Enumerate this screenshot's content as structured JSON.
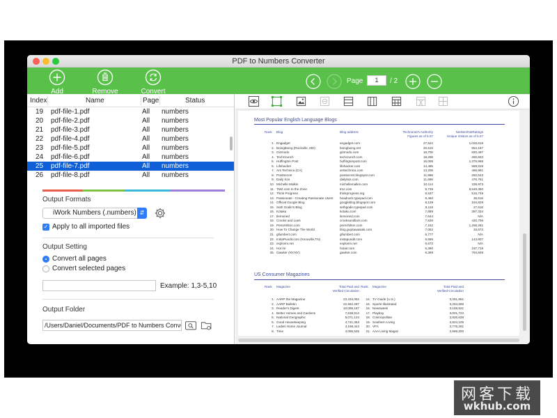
{
  "window": {
    "title": "PDF to Numbers Converter"
  },
  "toolbar": {
    "add_label": "Add",
    "remove_label": "Remove",
    "convert_label": "Convert",
    "page_label": "Page",
    "page_current": "1",
    "page_total": "/ 2"
  },
  "table": {
    "headers": {
      "index": "Index",
      "name": "Name",
      "page": "Page",
      "status": "Status"
    },
    "rows": [
      {
        "index": "19",
        "name": "pdf-file-1.pdf",
        "page": "All",
        "status": "numbers"
      },
      {
        "index": "20",
        "name": "pdf-file-2.pdf",
        "page": "All",
        "status": "numbers"
      },
      {
        "index": "21",
        "name": "pdf-file-3.pdf",
        "page": "All",
        "status": "numbers"
      },
      {
        "index": "22",
        "name": "pdf-file-4.pdf",
        "page": "All",
        "status": "numbers"
      },
      {
        "index": "23",
        "name": "pdf-file-5.pdf",
        "page": "All",
        "status": "numbers"
      },
      {
        "index": "24",
        "name": "pdf-file-6.pdf",
        "page": "All",
        "status": "numbers"
      },
      {
        "index": "25",
        "name": "pdf-file-7.pdf",
        "page": "All",
        "status": "numbers"
      },
      {
        "index": "26",
        "name": "pdf-file-8.pdf",
        "page": "All",
        "status": "numbers"
      }
    ],
    "selected_index": "25"
  },
  "output_formats": {
    "label": "Output Formats",
    "selected": "iWork Numbers (.numbers)",
    "apply_all_label": "Apply to all imported files"
  },
  "output_setting": {
    "label": "Output Setting",
    "convert_all_label": "Convert all pages",
    "convert_selected_label": "Convert selected pages",
    "range_value": "",
    "example_label": "Example: 1,3-5,10"
  },
  "output_folder": {
    "label": "Output Folder",
    "path": "/Users/Daniel/Documents/PDF to Numbers Converter"
  },
  "document": {
    "title1": "Most Popular English Language Blogs",
    "t1_headers": {
      "rank": "Rank",
      "blog": "Blog",
      "address": "Blog address",
      "authority1": "Technorati's Authority",
      "authority2": "Figures as of 5.07",
      "nielsen1": "Nielsen/NetRatings",
      "nielsen2": "Unique Visitors as of 5.07"
    },
    "t1_rows": [
      [
        "1.",
        "Engadget",
        "engadget.com",
        "27,524",
        "1,026,619"
      ],
      [
        "2.",
        "BoingBoing (Rockville, MD)",
        "boingboing.net",
        "20,519",
        "554,187"
      ],
      [
        "3.",
        "Gizmodo",
        "gizmodo.com",
        "18,700",
        "820,497"
      ],
      [
        "4.",
        "TechCrunch",
        "techcrunch.com",
        "18,298",
        "280,503"
      ],
      [
        "5.",
        "Huffington Post",
        "huffingtonpost.com",
        "16,009",
        "1,375,968"
      ],
      [
        "6.",
        "Lifehacker",
        "lifehacker.com",
        "14,485",
        "589,818"
      ],
      [
        "7.",
        "Ars Technica (CA)",
        "arstechnica.com",
        "13,208",
        "466,981"
      ],
      [
        "8.",
        "PostSecret",
        "postsecret.blogspot.com",
        "11,898",
        "282,643"
      ],
      [
        "9.",
        "Daily Kos",
        "dailykos.com",
        "11,696",
        "476,761"
      ],
      [
        "10.",
        "Michelle Malkin",
        "michellemalkin.com",
        "10,114",
        "338,973"
      ],
      [
        "11.",
        "TMZ.com In the Zone",
        "tmz.com",
        "9,739",
        "8,549,350"
      ],
      [
        "12.",
        "Think Progress",
        "thinkprogress.org",
        "8,537",
        "515,749"
      ],
      [
        "13.",
        "Passionate - Creating Passionate Users",
        "headrush.typepad.com",
        "8,460",
        "36,518"
      ],
      [
        "14.",
        "Official Google Blog",
        "googleblog.blogspot.com",
        "8,139",
        "194,829"
      ],
      [
        "15.",
        "Seth Godin's Blog",
        "sethgodin.typepad.com",
        "8,116",
        "27,618"
      ],
      [
        "16.",
        "Kotaku",
        "kotaku.com",
        "7,689",
        "397,334"
      ],
      [
        "17.",
        "Ilemoned",
        "ilemoned.com",
        "7,644",
        "N/A"
      ],
      [
        "18.",
        "Crooks and Liars",
        "crooksandliars.com",
        "7,536",
        "420,706"
      ],
      [
        "19.",
        "PerezHilton.com",
        "perezhilton.com",
        "7,152",
        "1,258,281"
      ],
      [
        "20.",
        "How To Change The World",
        "blog.guykawasaki.com",
        "7,052",
        "33,673"
      ],
      [
        "21.",
        "gllumbert.com",
        "gllumbert.com",
        "6,777",
        "N/A"
      ],
      [
        "22.",
        "InstaPundit.com (Knoxville,TN)",
        "instapundit.com",
        "6,695",
        "143,807"
      ],
      [
        "23.",
        "explosm.net",
        "explosm.net",
        "6,672",
        "N/A"
      ],
      [
        "24.",
        "Hot Air",
        "hotair.com",
        "6,390",
        "197,718"
      ],
      [
        "25.",
        "Gawker (NY,NY)",
        "gawker.com",
        "6,369",
        "794,849"
      ]
    ],
    "title2": "US Consumer Magazines",
    "t2_headers": {
      "rank": "Rank",
      "magazine": "Magazine",
      "paid1": "Total Paid and",
      "paid2": "Verified Circulation"
    },
    "t2_rows_left": [
      [
        "1.",
        "AARP the Magazine",
        "23,434,052"
      ],
      [
        "2.",
        "AARP Bulletin",
        "22,962,297"
      ],
      [
        "3.",
        "Reader's Digest",
        "10,099,167"
      ],
      [
        "4.",
        "Better Homes and Gardens",
        "7,638,912"
      ],
      [
        "5.",
        "National Geographic",
        "5,071,134"
      ],
      [
        "6.",
        "Good Housekeeping",
        "4,741,353"
      ],
      [
        "7.",
        "Ladies Home Journal",
        "4,169,444"
      ],
      [
        "8.",
        "Time",
        "4,086,535"
      ]
    ],
    "t2_rows_right": [
      [
        "14.",
        "TV Guide (U.S.)",
        "3,261,951"
      ],
      [
        "15.",
        "Sports Illustrated",
        "3,204,699"
      ],
      [
        "16.",
        "Newsweek",
        "3,159,931"
      ],
      [
        "17.",
        "Playboy",
        "3,001,723"
      ],
      [
        "18.",
        "Cosmopolitan",
        "2,826,638"
      ],
      [
        "19.",
        "Southern Living",
        "2,824,105"
      ],
      [
        "20.",
        "VFA",
        "2,778,291"
      ],
      [
        "21.",
        "AAA Living Magaz",
        "2,689,200"
      ]
    ]
  },
  "watermark": {
    "line1": "网客下载",
    "line2": "wkhub.com"
  },
  "colors": {
    "brand_green": "#59c14a",
    "selection_blue": "#0f5fd6",
    "accent_blue": "#2e7cf6",
    "doc_blue": "#3b4a9b"
  }
}
